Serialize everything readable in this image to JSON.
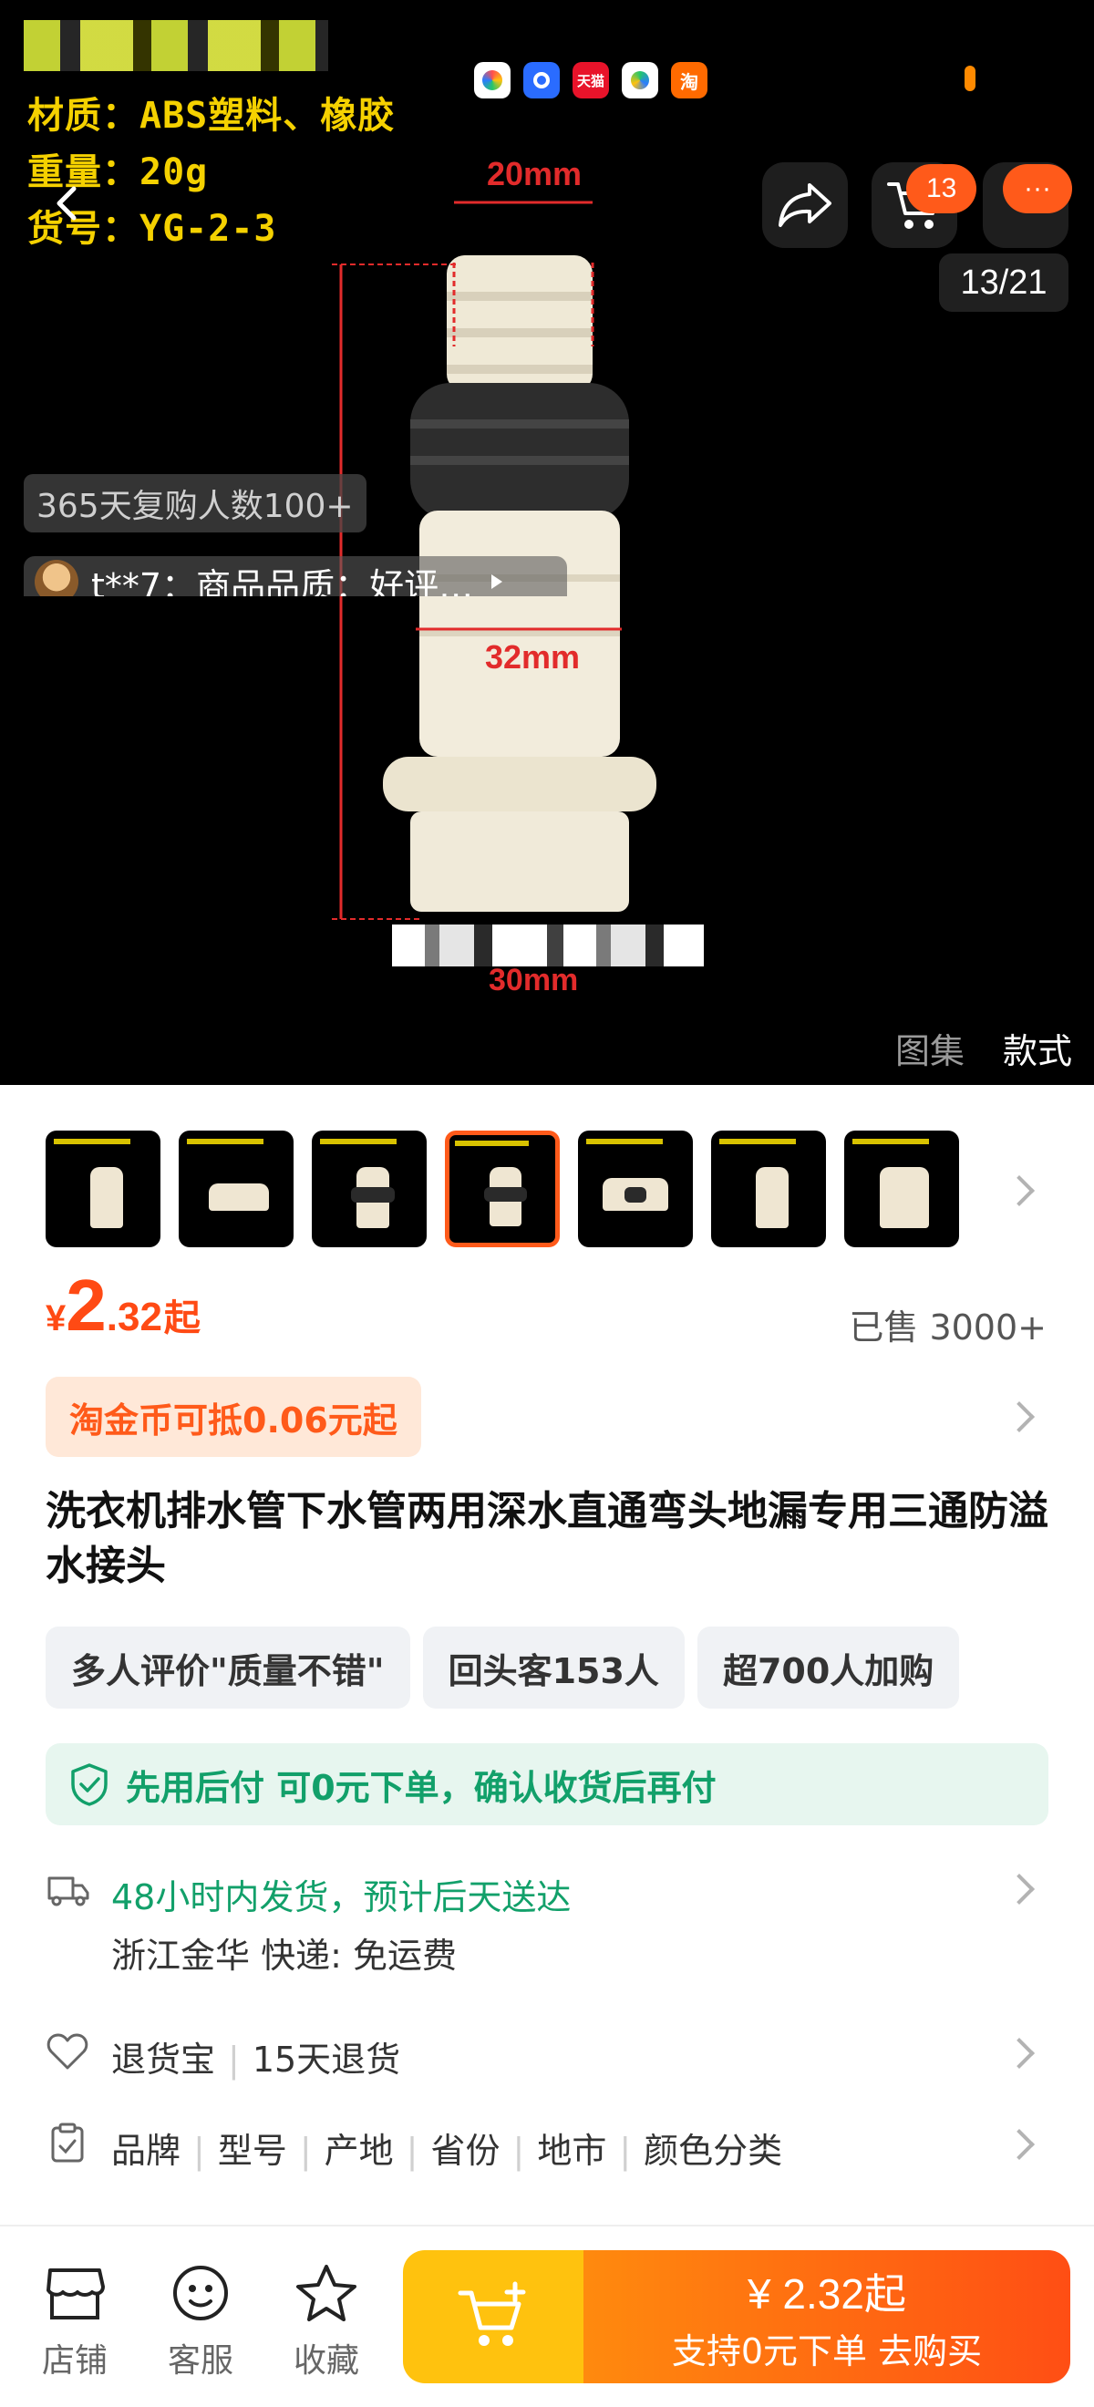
{
  "hero": {
    "spec_lines": [
      "材质：ABS塑料、橡胶",
      "重量：20g",
      "货号：YG-2-3"
    ],
    "dimension_labels": {
      "top": "20mm",
      "middle": "32mm",
      "bottom": "30mm"
    },
    "image_counter": "13/21",
    "cart_badge": "13",
    "more_badge": "···",
    "repurchase_text": "365天复购人数100+",
    "review_snippet": "t**7：商品品质：好评…",
    "tab_gallery": "图集",
    "tab_styles": "款式",
    "status_apps": [
      "app-1",
      "app-2",
      "天猫",
      "app-4",
      "淘"
    ]
  },
  "product": {
    "price_symbol": "¥",
    "price_int": "2",
    "price_dec": ".32",
    "price_suffix": "起",
    "sold": "已售 3000+",
    "coin_tag": "淘金币可抵0.06元起",
    "title": "洗衣机排水管下水管两用深水直通弯头地漏专用三通防溢水接头",
    "chips": [
      "多人评价\"质量不错\"",
      "回头客153人",
      "超700人加购"
    ],
    "paylater": "先用后付 可0元下单，确认收货后再付"
  },
  "shipping": {
    "line1": "48小时内发货，预计后天送达",
    "line2": "浙江金华  快递: 免运费"
  },
  "returns": {
    "label": "退货宝",
    "value": "15天退货"
  },
  "attrs": [
    "品牌",
    "型号",
    "产地",
    "省份",
    "地市",
    "颜色分类"
  ],
  "bottom": {
    "shop": "店铺",
    "service": "客服",
    "favorite": "收藏",
    "buy_price": "¥ 2.32起",
    "buy_sub": "支持0元下单  去购买"
  },
  "colors": {
    "accent": "#ff4a14",
    "green": "#12a06a",
    "cart_yellow": "#ffc20e"
  }
}
